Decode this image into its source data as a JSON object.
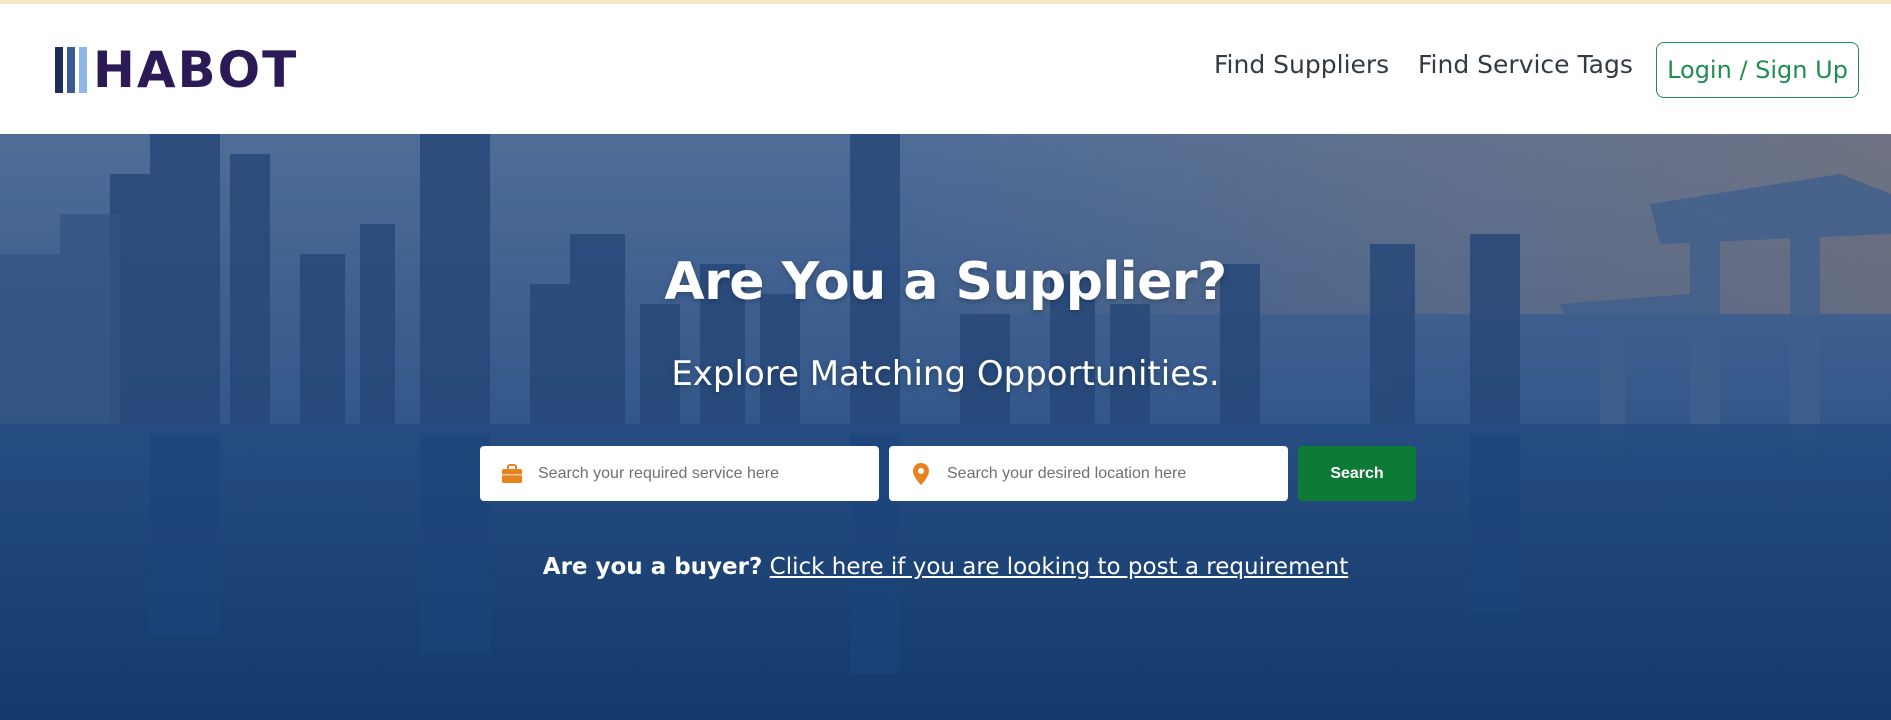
{
  "brand": {
    "name": "HABOT",
    "logo_icon": "striped-bars-logo",
    "colors": {
      "wordmark": "#2b1a56",
      "accent_green": "#1e8f4e",
      "search_button": "#0d7a36"
    }
  },
  "nav": {
    "links": [
      {
        "label": "Find Suppliers"
      },
      {
        "label": "Find Service Tags"
      }
    ],
    "login_label": "Login / Sign Up"
  },
  "hero": {
    "title": "Are You a Supplier?",
    "subtitle": "Explore Matching Opportunities.",
    "search": {
      "service_placeholder": "Search your required service here",
      "service_icon": "briefcase-icon",
      "location_placeholder": "Search your desired location here",
      "location_icon": "map-pin-icon",
      "button_label": "Search"
    },
    "buyer": {
      "question": "Are you a buyer?",
      "link_text": "Click here if you are looking to post a requirement"
    }
  }
}
